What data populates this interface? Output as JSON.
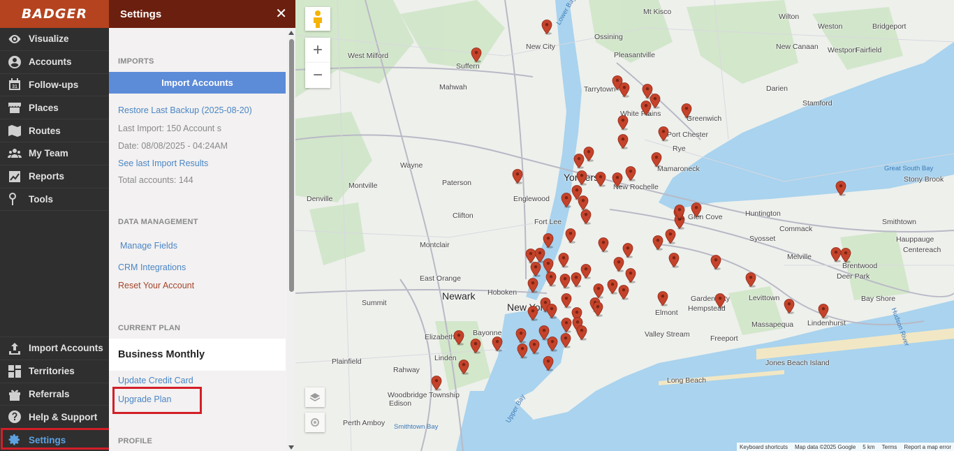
{
  "brand": {
    "name": "BADGER"
  },
  "nav": {
    "items": [
      {
        "label": "Visualize",
        "icon": "eye-icon"
      },
      {
        "label": "Accounts",
        "icon": "user-circle-icon"
      },
      {
        "label": "Follow-ups",
        "icon": "calendar-icon"
      },
      {
        "label": "Places",
        "icon": "store-icon"
      },
      {
        "label": "Routes",
        "icon": "map-icon"
      },
      {
        "label": "My Team",
        "icon": "team-icon"
      },
      {
        "label": "Reports",
        "icon": "chart-icon"
      },
      {
        "label": "Tools",
        "icon": "tools-icon"
      }
    ],
    "bottom_items": [
      {
        "label": "Import Accounts",
        "icon": "upload-icon"
      },
      {
        "label": "Territories",
        "icon": "grid-icon"
      },
      {
        "label": "Referrals",
        "icon": "gift-icon"
      },
      {
        "label": "Help & Support",
        "icon": "help-icon"
      },
      {
        "label": "Settings",
        "icon": "gear-icon",
        "active": true
      }
    ],
    "active_color": "#5da2e0"
  },
  "panel": {
    "title": "Settings",
    "imports": {
      "section_title": "IMPORTS",
      "import_button": "Import Accounts",
      "restore_link": "Restore Last Backup (2025-08-20)",
      "last_import": "Last Import: 150 Account s",
      "date": "Date: 08/08/2025 - 04:24AM",
      "results_link": "See last Import Results",
      "total": "Total accounts: 144"
    },
    "data_management": {
      "section_title": "DATA MANAGEMENT",
      "manage_fields": "Manage Fields",
      "crm": "CRM Integrations",
      "reset": "Reset Your Account"
    },
    "current_plan": {
      "section_title": "CURRENT PLAN",
      "plan_name": "Business Monthly",
      "update_card": "Update Credit Card",
      "upgrade": "Upgrade Plan"
    },
    "profile": {
      "section_title": "PROFILE"
    }
  },
  "map": {
    "labels": [
      {
        "text": "Ossining"
      },
      {
        "text": "New City"
      },
      {
        "text": "West Milford"
      },
      {
        "text": "Suffern"
      },
      {
        "text": "Pleasantville"
      },
      {
        "text": "Mt Kisco"
      },
      {
        "text": "Wilton"
      },
      {
        "text": "Weston"
      },
      {
        "text": "New Canaan"
      },
      {
        "text": "Westport"
      },
      {
        "text": "Fairfield"
      },
      {
        "text": "Bridgeport"
      },
      {
        "text": "Mahwah"
      },
      {
        "text": "Tarrytown"
      },
      {
        "text": "Darien"
      },
      {
        "text": "Stamford"
      },
      {
        "text": "White Plains"
      },
      {
        "text": "Greenwich"
      },
      {
        "text": "Port Chester"
      },
      {
        "text": "Rye"
      },
      {
        "text": "Wayne"
      },
      {
        "text": "Paterson"
      },
      {
        "text": "Yonkers"
      },
      {
        "text": "Mamaroneck"
      },
      {
        "text": "New Rochelle"
      },
      {
        "text": "Montville"
      },
      {
        "text": "Englewood"
      },
      {
        "text": "Denville"
      },
      {
        "text": "Clifton"
      },
      {
        "text": "Fort Lee"
      },
      {
        "text": "Glen Cove"
      },
      {
        "text": "Huntington"
      },
      {
        "text": "Commack"
      },
      {
        "text": "Smithtown"
      },
      {
        "text": "Stony Brook"
      },
      {
        "text": "Montclair"
      },
      {
        "text": "Syosset"
      },
      {
        "text": "Hauppauge"
      },
      {
        "text": "Centereach"
      },
      {
        "text": "Melville"
      },
      {
        "text": "Brentwood"
      },
      {
        "text": "Deer Park"
      },
      {
        "text": "East Orange"
      },
      {
        "text": "Newark"
      },
      {
        "text": "Hoboken"
      },
      {
        "text": "New York"
      },
      {
        "text": "Summit"
      },
      {
        "text": "Garden City"
      },
      {
        "text": "Levittown"
      },
      {
        "text": "Bay Shore"
      },
      {
        "text": "Hempstead"
      },
      {
        "text": "Elmont"
      },
      {
        "text": "Massapequa"
      },
      {
        "text": "Lindenhurst"
      },
      {
        "text": "Elizabeth"
      },
      {
        "text": "Bayonne"
      },
      {
        "text": "Valley Stream"
      },
      {
        "text": "Freeport"
      },
      {
        "text": "Plainfield"
      },
      {
        "text": "Linden"
      },
      {
        "text": "Rahway"
      },
      {
        "text": "Jones Beach Island"
      },
      {
        "text": "Long Beach"
      },
      {
        "text": "Woodbridge Township"
      },
      {
        "text": "Edison"
      },
      {
        "text": "Perth Amboy"
      },
      {
        "text": "Smithtown Bay"
      },
      {
        "text": "Great South Bay"
      },
      {
        "text": "Hudson River"
      },
      {
        "text": "Lower Bay"
      },
      {
        "text": "Upper Bay"
      }
    ],
    "attribution": [
      "Keyboard shortcuts",
      "Map data ©2025 Google",
      "5 km",
      "Terms",
      "Report a map error"
    ],
    "zoom_in": "+",
    "zoom_out": "−",
    "pin_color": "#c5432b",
    "water_color": "#a9d3ee"
  }
}
